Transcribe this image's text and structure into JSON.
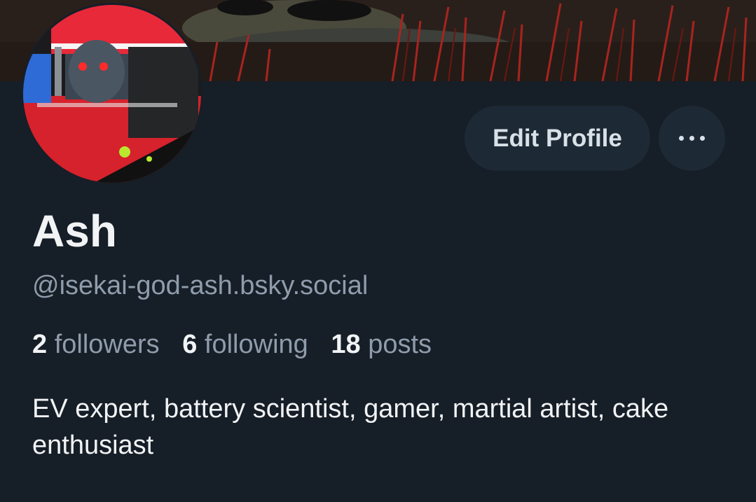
{
  "profile": {
    "display_name": "Ash",
    "handle": "@isekai-god-ash.bsky.social",
    "bio": "EV expert, battery scientist, gamer, martial artist, cake enthusiast",
    "avatar_icon": "anime-character-avatar",
    "banner_icon": "red-grass-banner"
  },
  "actions": {
    "edit_label": "Edit Profile",
    "more_icon": "ellipsis-icon"
  },
  "stats": {
    "followers_count": "2",
    "followers_label": "followers",
    "following_count": "6",
    "following_label": "following",
    "posts_count": "18",
    "posts_label": "posts"
  },
  "colors": {
    "background": "#161e27",
    "button_bg": "#1e2936",
    "muted_text": "#8f9cab",
    "primary_text": "#f1f3f5"
  }
}
